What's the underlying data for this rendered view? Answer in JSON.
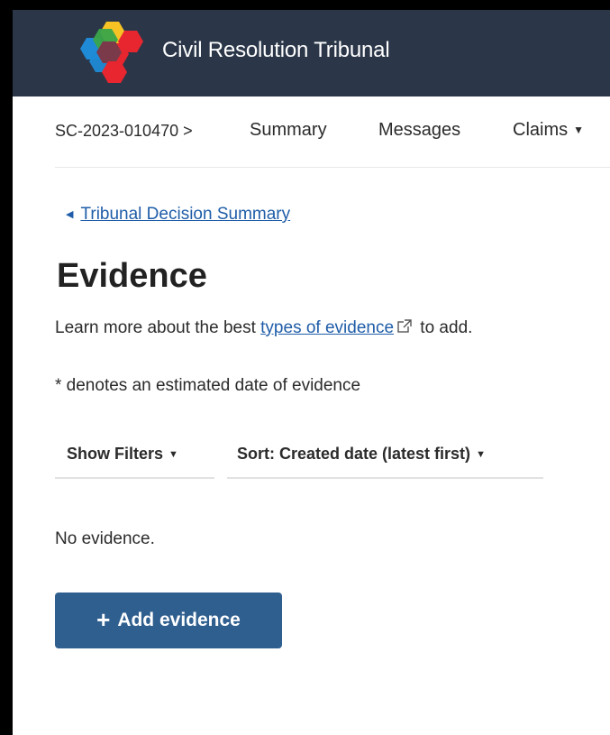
{
  "header": {
    "app_title": "Civil Resolution Tribunal",
    "logo_icon": "crt-hexagon-logo",
    "bg_color": "#2b3749"
  },
  "nav": {
    "case_number": "SC-2023-010470 >",
    "items": [
      {
        "label": "Summary"
      },
      {
        "label": "Messages"
      },
      {
        "label": "Claims",
        "has_dropdown": true
      }
    ],
    "dropdown_icon": "caret-down-icon"
  },
  "back_link": {
    "label": "Tribunal Decision Summary",
    "icon": "chevron-left-icon"
  },
  "page": {
    "title": "Evidence",
    "intro_before": "Learn more about the best ",
    "intro_link": "types of evidence",
    "intro_after": " to add.",
    "estimate_note": "* denotes an estimated date of evidence"
  },
  "filters": {
    "show_filters": "Show Filters",
    "sort": "Sort: Created date (latest first)"
  },
  "empty_state": "No evidence.",
  "add_button": {
    "plus": "+",
    "label": "Add evidence",
    "color": "#2f5f8f"
  },
  "colors": {
    "link": "#1f5da8",
    "text": "#2b2b2b"
  }
}
